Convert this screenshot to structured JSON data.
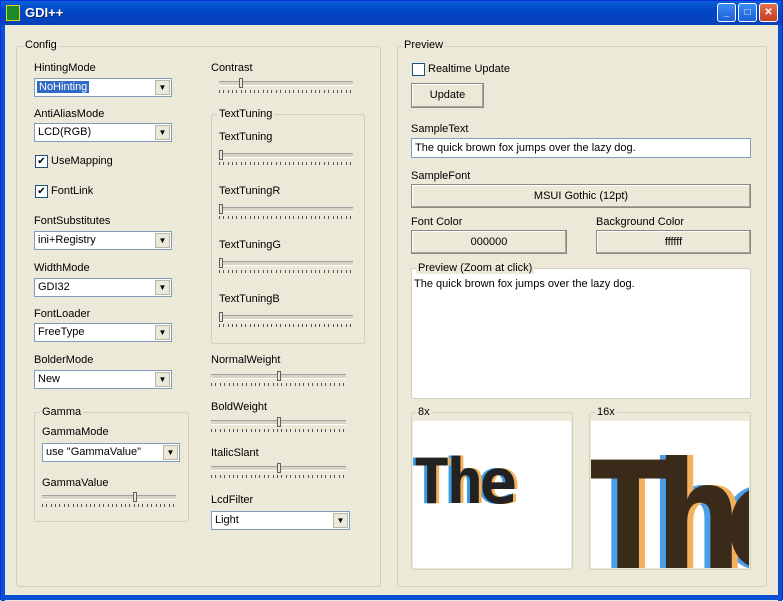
{
  "window": {
    "title": "GDI++"
  },
  "config": {
    "group_label": "Config",
    "hinting": {
      "label": "HintingMode",
      "value": "NoHinting"
    },
    "antialias": {
      "label": "AntiAliasMode",
      "value": "LCD(RGB)"
    },
    "use_mapping": {
      "label": "UseMapping",
      "checked": true
    },
    "font_link": {
      "label": "FontLink",
      "checked": true
    },
    "font_substitutes": {
      "label": "FontSubstitutes",
      "value": "ini+Registry"
    },
    "width_mode": {
      "label": "WidthMode",
      "value": "GDI32"
    },
    "font_loader": {
      "label": "FontLoader",
      "value": "FreeType"
    },
    "bolder_mode": {
      "label": "BolderMode",
      "value": "New"
    },
    "gamma": {
      "group_label": "Gamma",
      "mode_label": "GammaMode",
      "mode_value": "use \"GammaValue\"",
      "value_label": "GammaValue",
      "value_level": 0.7
    },
    "contrast": {
      "label": "Contrast",
      "level": 0.15
    },
    "text_tuning": {
      "group_label": "TextTuning",
      "items": [
        {
          "label": "TextTuning",
          "level": 0.0
        },
        {
          "label": "TextTuningR",
          "level": 0.0
        },
        {
          "label": "TextTuningG",
          "level": 0.0
        },
        {
          "label": "TextTuningB",
          "level": 0.0
        }
      ]
    },
    "normal_weight": {
      "label": "NormalWeight",
      "level": 0.5
    },
    "bold_weight": {
      "label": "BoldWeight",
      "level": 0.5
    },
    "italic_slant": {
      "label": "ItalicSlant",
      "level": 0.5
    },
    "lcd_filter": {
      "label": "LcdFilter",
      "value": "Light"
    }
  },
  "preview": {
    "group_label": "Preview",
    "realtime": {
      "label": "Realtime Update",
      "checked": false
    },
    "update_button": "Update",
    "sample_text_label": "SampleText",
    "sample_text_value": "The quick brown fox jumps over the lazy dog.",
    "sample_font_label": "SampleFont",
    "sample_font_button": "MSUI Gothic (12pt)",
    "font_color_label": "Font Color",
    "font_color_button": "000000",
    "background_color_label": "Background Color",
    "background_color_button": "ffffff",
    "preview_box_label": "Preview (Zoom at click)",
    "preview_box_text": "The quick brown fox jumps over the lazy dog.",
    "zoom8_label": "8x",
    "zoom16_label": "16x",
    "zoom_glyphs": "The"
  },
  "colors": {
    "titlebar": "#0047c7",
    "selection": "#316ac5",
    "face": "#ece9d8"
  }
}
